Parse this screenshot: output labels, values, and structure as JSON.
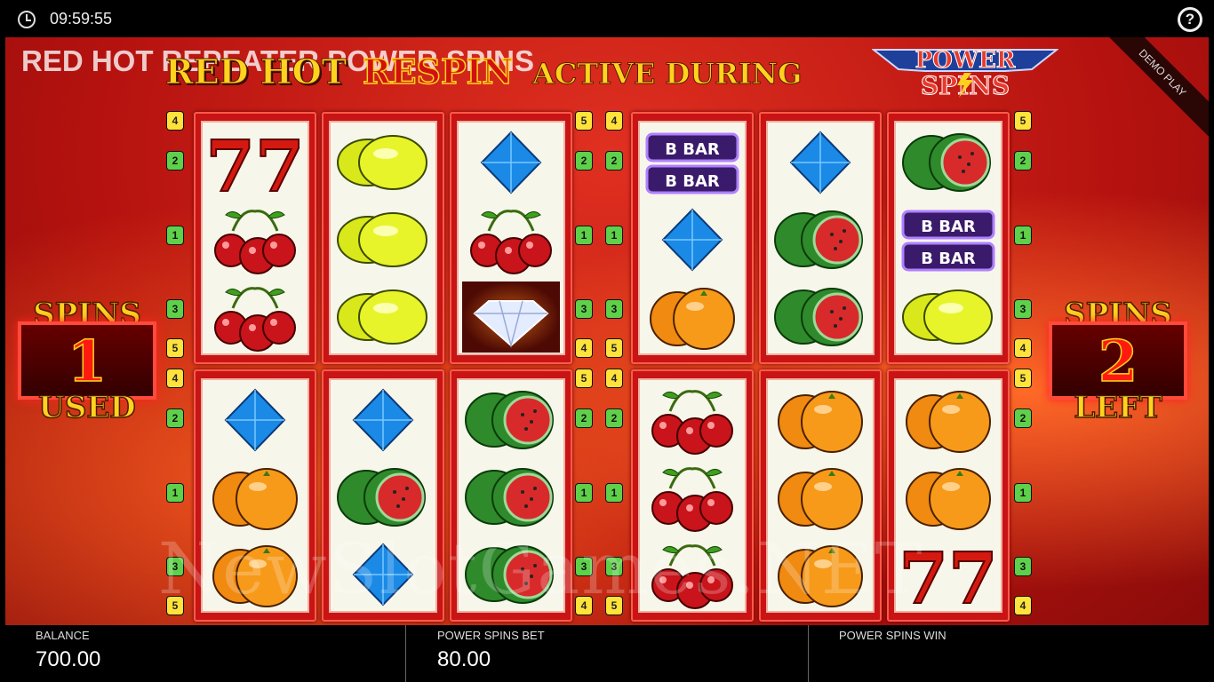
{
  "topbar": {
    "time": "09:59:55",
    "clock_icon": "clock-icon",
    "help_glyph": "?"
  },
  "game": {
    "title": "RED HOT REPEATER POWER SPINS",
    "banner": {
      "part1": "RED HOT",
      "part2": "RESPIN",
      "part3": "ACTIVE DURING"
    },
    "logo": {
      "line1": "POWER",
      "line2": "SPINS"
    },
    "demo_label": "DEMO PLAY"
  },
  "spins_used": {
    "top": "SPINS",
    "value": "1",
    "bottom": "USED"
  },
  "spins_left": {
    "top": "SPINS",
    "value": "2",
    "bottom": "LEFT"
  },
  "grids": [
    {
      "name": "top-left",
      "reels": [
        [
          "seven",
          "cherry",
          "cherry"
        ],
        [
          "lemon",
          "lemon",
          "lemon"
        ],
        [
          "diamond",
          "cherry",
          "wild-diamond"
        ]
      ]
    },
    {
      "name": "top-right",
      "reels": [
        [
          "bar",
          "diamond",
          "orange"
        ],
        [
          "diamond",
          "melon",
          "melon"
        ],
        [
          "melon",
          "bar",
          "lemon"
        ]
      ]
    },
    {
      "name": "bottom-left",
      "reels": [
        [
          "diamond",
          "orange",
          "orange"
        ],
        [
          "diamond",
          "melon",
          "diamond"
        ],
        [
          "melon",
          "melon",
          "melon"
        ]
      ]
    },
    {
      "name": "bottom-right",
      "reels": [
        [
          "cherry",
          "cherry",
          "cherry"
        ],
        [
          "orange",
          "orange",
          "orange"
        ],
        [
          "orange",
          "orange",
          "seven"
        ]
      ]
    }
  ],
  "paylines": {
    "left": [
      "4",
      "2",
      "1",
      "3",
      "5"
    ],
    "mid_left": [
      "5",
      "2",
      "1",
      "3",
      "4"
    ],
    "mid_right": [
      "4",
      "2",
      "1",
      "3",
      "5"
    ],
    "right": [
      "5",
      "2",
      "1",
      "3",
      "4"
    ]
  },
  "watermark": "NewSlotGames.NET",
  "bottombar": {
    "balance": {
      "label": "BALANCE",
      "value": "700.00"
    },
    "bet": {
      "label": "POWER SPINS BET",
      "value": "80.00"
    },
    "win": {
      "label": "POWER SPINS WIN",
      "value": ""
    }
  },
  "colors": {
    "background": "#b5120f",
    "reel_border": "#c81414",
    "banner_yellow": "#ffd21e",
    "payline_green": "#5ed04a",
    "payline_yellow": "#ffe23a"
  }
}
